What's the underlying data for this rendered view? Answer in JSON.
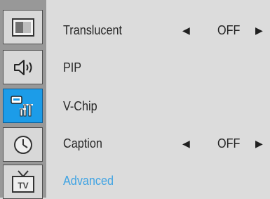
{
  "sidebar": {
    "tabs": [
      {
        "name": "picture",
        "icon": "picture-icon",
        "active": false
      },
      {
        "name": "sound",
        "icon": "speaker-icon",
        "active": false
      },
      {
        "name": "setup",
        "icon": "setup-tools-icon",
        "active": true
      },
      {
        "name": "time",
        "icon": "clock-icon",
        "active": false
      },
      {
        "name": "input",
        "icon": "tv-icon",
        "active": false
      }
    ]
  },
  "menu": {
    "items": [
      {
        "label": "Translucent",
        "value": "OFF",
        "left_arrow": "◀",
        "right_arrow": "▶"
      },
      {
        "label": "PIP"
      },
      {
        "label": "V-Chip"
      },
      {
        "label": "Caption",
        "value": "OFF",
        "left_arrow": "◀",
        "right_arrow": "▶"
      },
      {
        "label": "Advanced",
        "highlight": true
      }
    ]
  },
  "colors": {
    "highlight": "#3fa3e3",
    "active_tab": "#1c9ce8",
    "sidebar": "#989898",
    "background": "#dcdcdc"
  }
}
